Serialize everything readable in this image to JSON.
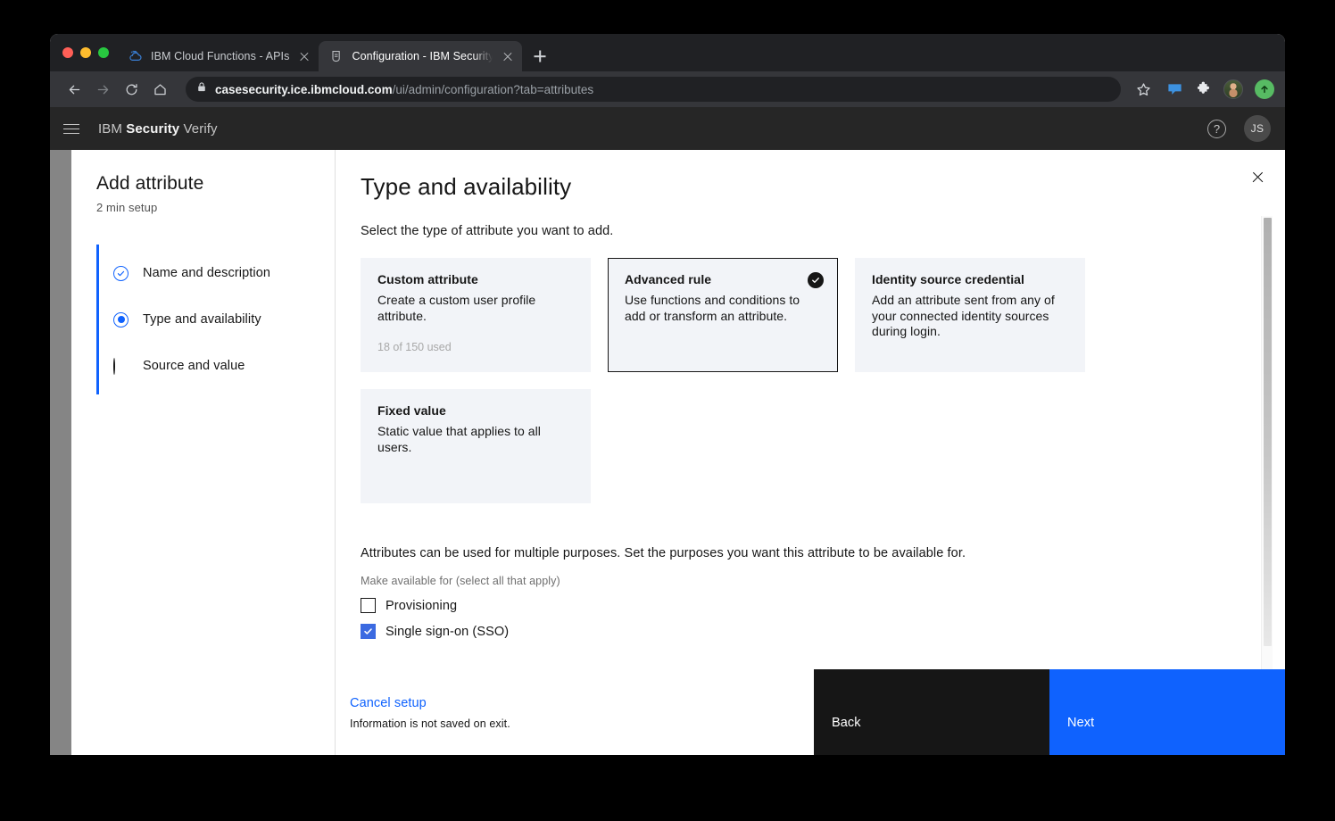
{
  "browser": {
    "tabs": [
      {
        "title": "IBM Cloud Functions - APIs",
        "favicon": "ibm-cloud-icon",
        "active": false
      },
      {
        "title": "Configuration - IBM Security Ve",
        "favicon": "shield-icon",
        "active": true
      }
    ],
    "new_tab_label": "+",
    "url_host": "casesecurity.ice.ibmcloud.com",
    "url_path": "/ui/admin/configuration?tab=attributes",
    "toolbar_icons": [
      "back-icon",
      "forward-icon",
      "reload-icon",
      "home-icon",
      "lock-icon",
      "bookmark-star-icon",
      "chat-bubble-icon",
      "extensions-puzzle-icon",
      "profile-avatar",
      "upload-arrow-icon"
    ]
  },
  "app": {
    "brand_prefix": "IBM ",
    "brand_bold": "Security",
    "brand_suffix": " Verify",
    "help_glyph": "?",
    "user_initials": "JS"
  },
  "sidebar": {
    "title": "Add attribute",
    "subtitle": "2 min setup",
    "steps": [
      {
        "label": "Name and description",
        "state": "done"
      },
      {
        "label": "Type and availability",
        "state": "current"
      },
      {
        "label": "Source and value",
        "state": "todo"
      }
    ]
  },
  "main": {
    "title": "Type and availability",
    "lead": "Select the type of attribute you want to add.",
    "cards": [
      {
        "title": "Custom attribute",
        "desc": "Create a custom user profile attribute.",
        "meta": "18 of 150 used",
        "selected": false
      },
      {
        "title": "Advanced rule",
        "desc": "Use functions and conditions to add or transform an attribute.",
        "meta": "",
        "selected": true
      },
      {
        "title": "Identity source credential",
        "desc": "Add an attribute sent from any of your connected identity sources during login.",
        "meta": "",
        "selected": false
      },
      {
        "title": "Fixed value",
        "desc": "Static value that applies to all users.",
        "meta": "",
        "selected": false
      }
    ],
    "purpose_text": "Attributes can be used for multiple purposes. Set the purposes you want this attribute to be available for.",
    "purpose_label": "Make available for (select all that apply)",
    "checkboxes": [
      {
        "label": "Provisioning",
        "checked": false
      },
      {
        "label": "Single sign-on (SSO)",
        "checked": true
      }
    ]
  },
  "footer": {
    "cancel_label": "Cancel setup",
    "cancel_sub": "Information is not saved on exit.",
    "back_label": "Back",
    "next_label": "Next"
  },
  "colors": {
    "accent_blue": "#0f62fe",
    "checkbox_blue": "#3b6ae1",
    "dark": "#161616",
    "card_bg": "#f2f4f8"
  }
}
